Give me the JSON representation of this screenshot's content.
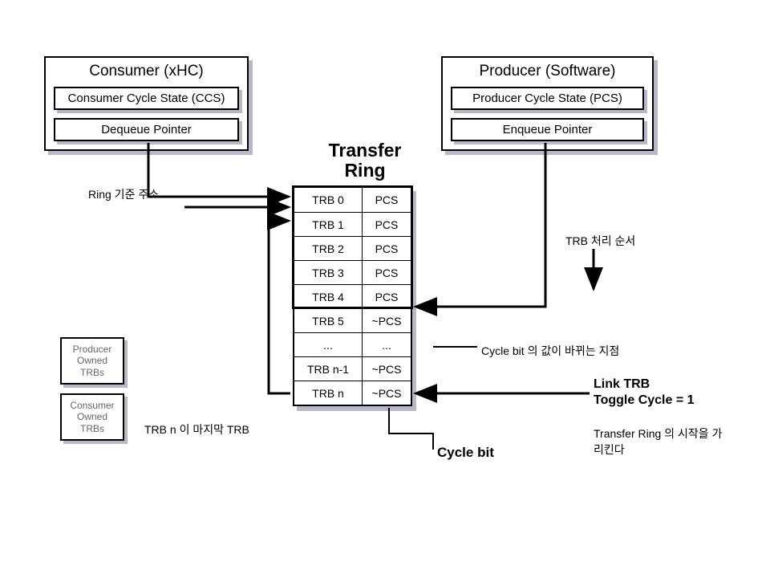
{
  "consumer_panel": {
    "title": "Consumer (xHC)",
    "ccs": "Consumer Cycle State (CCS)",
    "deq": "Dequeue Pointer"
  },
  "producer_panel": {
    "title": "Producer (Software)",
    "pcs": "Producer Cycle State (PCS)",
    "enq": "Enqueue Pointer"
  },
  "ring_title_line1": "Transfer",
  "ring_title_line2": "Ring",
  "trb_rows": [
    {
      "name": "TRB 0",
      "cycle": "PCS"
    },
    {
      "name": "TRB 1",
      "cycle": "PCS"
    },
    {
      "name": "TRB 2",
      "cycle": "PCS"
    },
    {
      "name": "TRB 3",
      "cycle": "PCS"
    },
    {
      "name": "TRB 4",
      "cycle": "PCS"
    },
    {
      "name": "TRB 5",
      "cycle": "~PCS"
    },
    {
      "name": "...",
      "cycle": "..."
    },
    {
      "name": "TRB n-1",
      "cycle": "~PCS"
    },
    {
      "name": "TRB n",
      "cycle": "~PCS"
    }
  ],
  "producer_owned_count": 5,
  "side_producer": "Producer\nOwned\nTRBs",
  "side_consumer": "Consumer\nOwned\nTRBs",
  "ann_ring_base": "Ring 기준 주소",
  "ann_trb_order": "TRB 처리 순서",
  "ann_cycle_change": "Cycle bit 의 값이 바뀌는 지점",
  "ann_link_trb": "Link TRB",
  "ann_toggle": "Toggle Cycle = 1",
  "ann_last_trb": "TRB n 이 마지막 TRB",
  "ann_transfer_start": "Transfer Ring 의 시작을 가리킨다",
  "cycle_bit_label": "Cycle bit"
}
